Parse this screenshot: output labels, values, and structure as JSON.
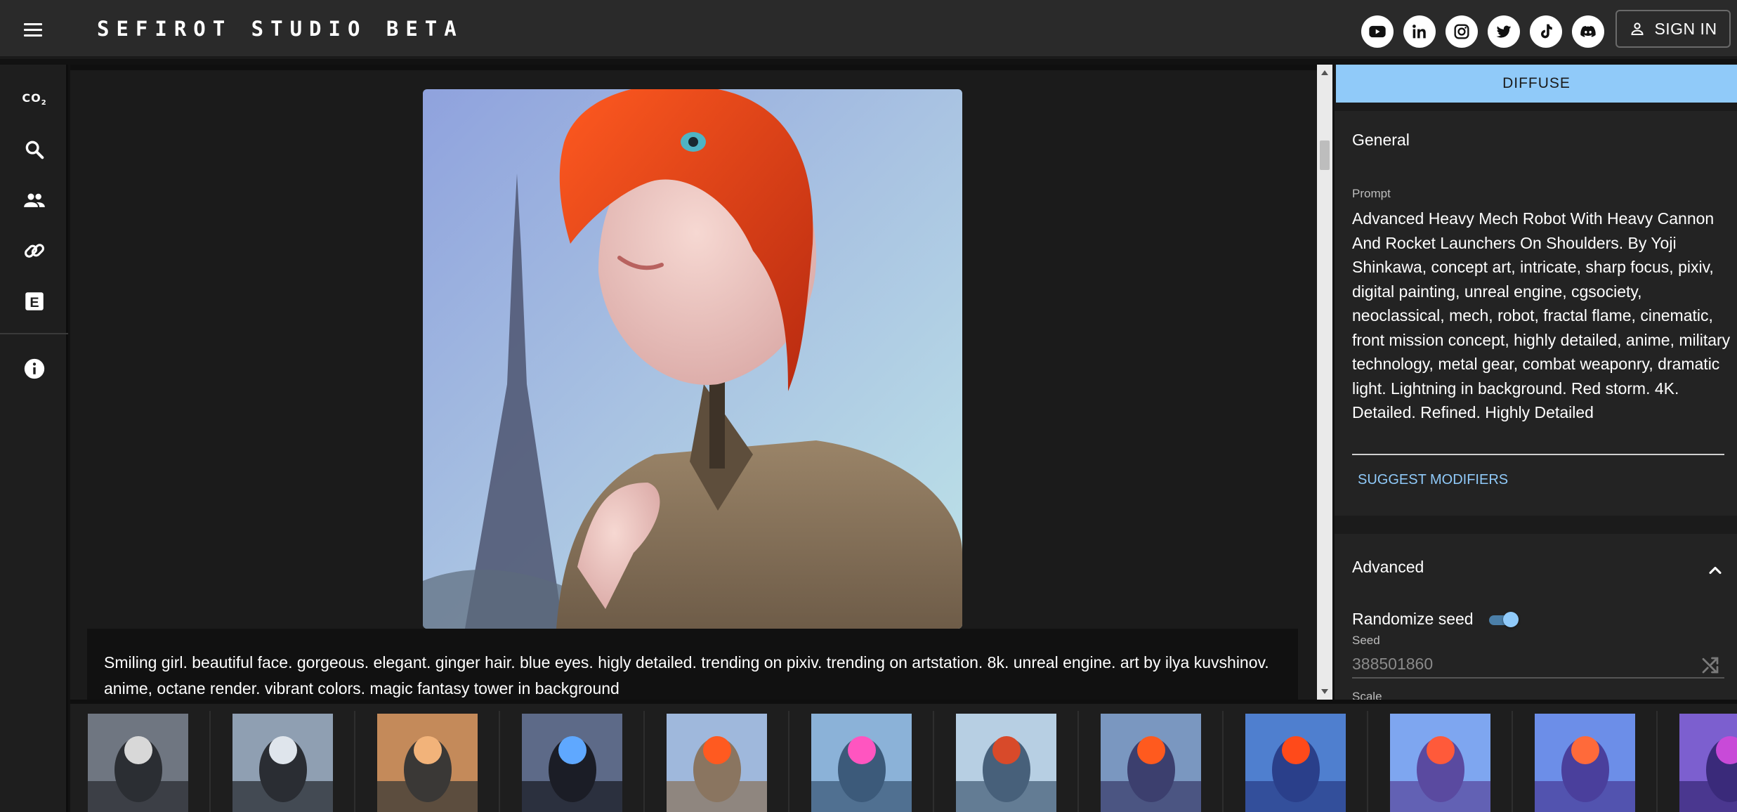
{
  "app": {
    "title": "SEFIROT STUDIO BETA",
    "sign_in_label": "SIGN IN",
    "socials": [
      "youtube-icon",
      "linkedin-icon",
      "instagram-icon",
      "twitter-icon",
      "tiktok-icon",
      "discord-icon"
    ]
  },
  "rail": {
    "items": [
      "co2-icon",
      "search-icon",
      "people-icon",
      "link-icon",
      "e-badge-icon",
      "info-icon"
    ],
    "co2_label": "CO",
    "co2_sub": "2",
    "e_label": "E"
  },
  "main": {
    "caption": "Smiling girl. beautiful face. gorgeous. elegant. ginger hair. blue eyes. higly detailed. trending on pixiv. trending on artstation. 8k. unreal engine. art by ilya kuvshinov. anime, octane render. vibrant colors. magic fantasy tower in background"
  },
  "side": {
    "diffuse_label": "DIFFUSE",
    "general": {
      "title": "General",
      "prompt_label": "Prompt",
      "prompt": "Advanced Heavy Mech Robot With Heavy Cannon And Rocket Launchers On Shoulders. By Yoji Shinkawa, concept art, intricate, sharp focus, pixiv, digital painting, unreal engine, cgsociety, neoclassical, mech, robot, fractal flame, cinematic, front mission concept, highly detailed, anime, military technology, metal gear, combat weaponry, dramatic light. Lightning in background. Red storm. 4K. Detailed. Refined. Highly Detailed",
      "suggest_label": "SUGGEST MODIFIERS"
    },
    "advanced": {
      "title": "Advanced",
      "randomize_label": "Randomize seed",
      "randomize_on": true,
      "seed_label": "Seed",
      "seed_value": "388501860",
      "scale_label": "Scale"
    }
  },
  "colors": {
    "accent": "#90caf9",
    "topbar": "#2a2a2a",
    "background": "#1b1b1b"
  },
  "thumbnails": [
    "mech-robot-winged",
    "mech-robot-cannon",
    "mech-robot-sunset",
    "mech-robot-blue-lights",
    "ginger-girl-eiffel",
    "girl-pink-tower",
    "girl-city-profile",
    "ginger-girl-portrait",
    "redhead-girl-closeup",
    "redhead-girl-castle",
    "redhead-girl-castle-2",
    "castle-purple"
  ]
}
